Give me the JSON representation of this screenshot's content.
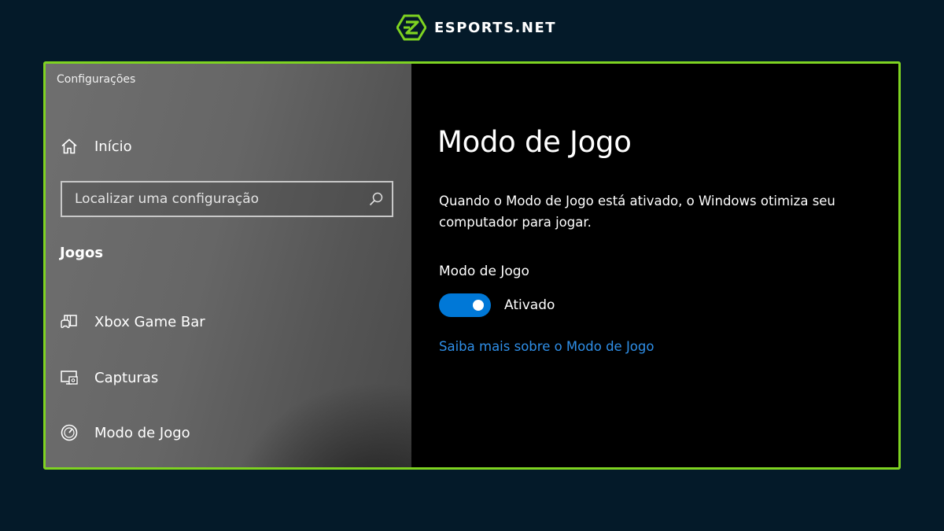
{
  "brand": {
    "name": "ESPORTS.NET",
    "accent_color": "#7ed321",
    "logo_icon": "esports-logo"
  },
  "window": {
    "title": "Configurações"
  },
  "sidebar": {
    "home": {
      "label": "Início",
      "icon": "home-icon"
    },
    "search": {
      "placeholder": "Localizar uma configuração",
      "value": "",
      "icon": "search-icon"
    },
    "section": "Jogos",
    "items": [
      {
        "label": "Xbox Game Bar",
        "icon": "game-bar-icon"
      },
      {
        "label": "Capturas",
        "icon": "captures-icon"
      },
      {
        "label": "Modo de Jogo",
        "icon": "game-mode-icon"
      }
    ]
  },
  "content": {
    "title": "Modo de Jogo",
    "description": "Quando o Modo de Jogo está ativado, o Windows otimiza seu computador para jogar.",
    "toggle_label": "Modo de Jogo",
    "toggle_state": "Ativado",
    "toggle_on": true,
    "toggle_color": "#0078d7",
    "link": "Saiba mais sobre o Modo de Jogo",
    "link_color": "#2f8fe8"
  }
}
